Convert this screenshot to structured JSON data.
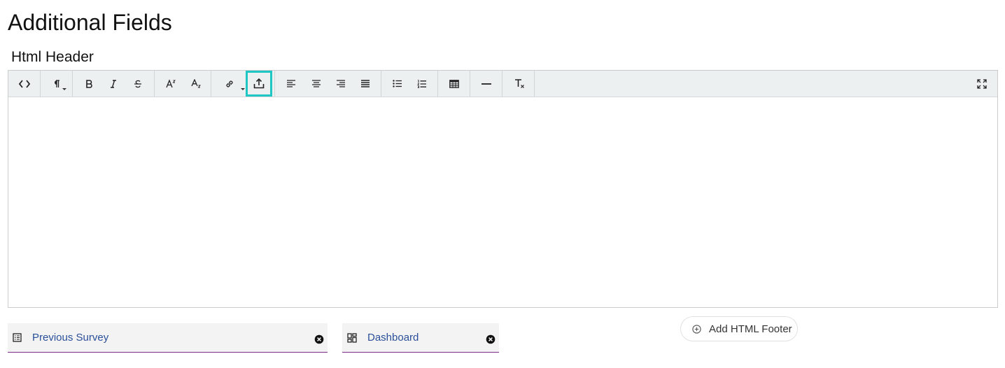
{
  "page": {
    "title": "Additional Fields",
    "section_label": "Html Header"
  },
  "toolbar": {
    "buttons": [
      {
        "name": "code-view",
        "icon": "code-icon"
      },
      {
        "name": "paragraph-format",
        "icon": "paragraph-icon"
      },
      {
        "name": "bold",
        "icon": "bold-icon"
      },
      {
        "name": "italic",
        "icon": "italic-icon"
      },
      {
        "name": "strikethrough",
        "icon": "strikethrough-icon"
      },
      {
        "name": "superscript",
        "icon": "superscript-icon"
      },
      {
        "name": "subscript",
        "icon": "subscript-icon"
      },
      {
        "name": "insert-link",
        "icon": "link-icon"
      },
      {
        "name": "upload",
        "icon": "upload-icon"
      },
      {
        "name": "align-left",
        "icon": "align-left-icon"
      },
      {
        "name": "align-center",
        "icon": "align-center-icon"
      },
      {
        "name": "align-right",
        "icon": "align-right-icon"
      },
      {
        "name": "align-justify",
        "icon": "align-justify-icon"
      },
      {
        "name": "bulleted-list",
        "icon": "bulleted-list-icon"
      },
      {
        "name": "numbered-list",
        "icon": "numbered-list-icon"
      },
      {
        "name": "insert-table",
        "icon": "table-icon"
      },
      {
        "name": "horizontal-line",
        "icon": "horizontal-line-icon"
      },
      {
        "name": "clear-formatting",
        "icon": "clear-format-icon"
      },
      {
        "name": "fullscreen",
        "icon": "fullscreen-icon"
      }
    ],
    "highlighted": "upload",
    "highlight_color": "#1fc7c4"
  },
  "editor": {
    "content": ""
  },
  "chips": [
    {
      "label": "Previous Survey",
      "icon": "list-icon"
    },
    {
      "label": "Dashboard",
      "icon": "dashboard-icon"
    }
  ],
  "footer_button": {
    "label": "Add HTML Footer",
    "icon": "plus-circle-icon"
  },
  "colors": {
    "chip_text": "#2a4f9b",
    "chip_underline": "#7a2a86",
    "toolbar_bg": "#edf0f1"
  }
}
